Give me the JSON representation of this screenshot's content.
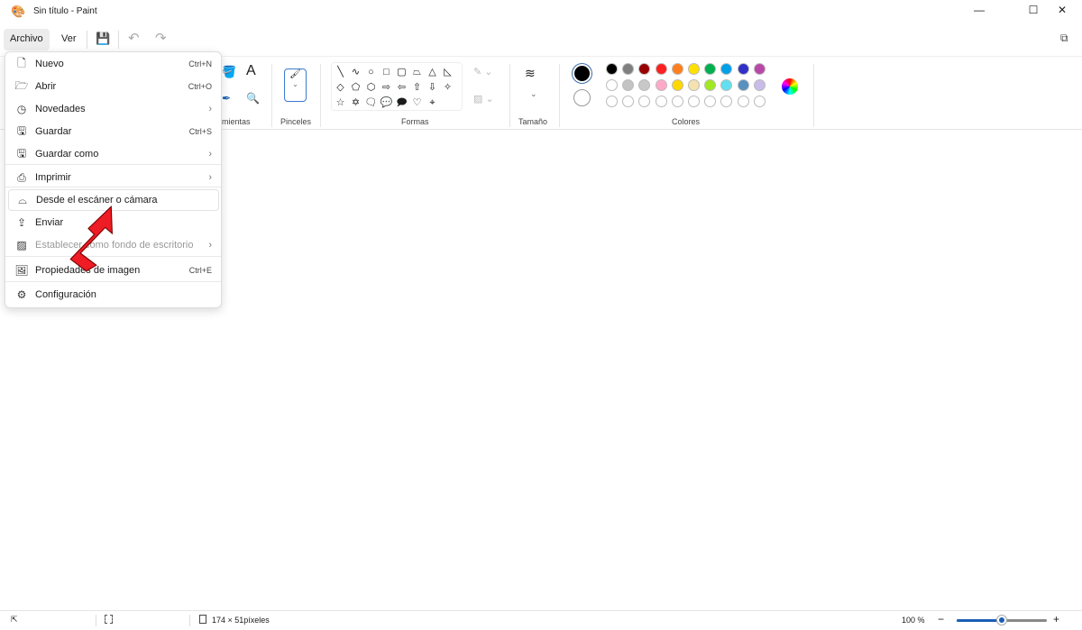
{
  "window": {
    "title": "Sin título - Paint",
    "minimize": "—",
    "maximize": "☐",
    "close": "✕"
  },
  "menubar": {
    "archivo": "Archivo",
    "ver": "Ver"
  },
  "ribbon": {
    "groups": {
      "herramientas": "mientas",
      "pinceles": "Pinceles",
      "formas": "Formas",
      "tamano": "Tamaño",
      "colores": "Colores"
    },
    "shapes": [
      "╲",
      "∿",
      "○",
      "□",
      "▢",
      "⏢",
      "△",
      "◺",
      "◇",
      "⬠",
      "⬡",
      "⇨",
      "⇦",
      "⇧",
      "⇩",
      "✧",
      "☆",
      "✡",
      "🗨",
      "💬",
      "🗩",
      "♡",
      "⌖"
    ],
    "primary_color": "#000000",
    "secondary_color": "#ffffff",
    "palette": [
      [
        "#000000",
        "#7f7f7f",
        "#990000",
        "#ff2020",
        "#ff7f1e",
        "#ffe000",
        "#00b04f",
        "#00a0e8",
        "#3030c8",
        "#b848a8"
      ],
      [
        "#ffffff",
        "#c3c3c3",
        "#c8c8c8",
        "#ffa8c8",
        "#ffd800",
        "#f5e2b0",
        "#a0e820",
        "#60e0f0",
        "#5890c0",
        "#c8bce8"
      ],
      [
        "#ffffff",
        "#ffffff",
        "#ffffff",
        "#ffffff",
        "#ffffff",
        "#ffffff",
        "#ffffff",
        "#ffffff",
        "#ffffff",
        "#ffffff"
      ]
    ]
  },
  "file_menu": {
    "items": [
      {
        "label": "Nuevo",
        "shortcut": "Ctrl+N",
        "icon": "new-file-icon"
      },
      {
        "label": "Abrir",
        "shortcut": "Ctrl+O",
        "icon": "folder-icon"
      },
      {
        "label": "Novedades",
        "submenu": true,
        "icon": "clock-icon"
      },
      {
        "label": "Guardar",
        "shortcut": "Ctrl+S",
        "icon": "save-icon"
      },
      {
        "label": "Guardar como",
        "submenu": true,
        "icon": "save-as-icon"
      },
      {
        "label": "Imprimir",
        "submenu": true,
        "icon": "printer-icon"
      },
      {
        "label": "Desde el escáner o cámara",
        "icon": "scanner-icon"
      },
      {
        "label": "Enviar",
        "icon": "share-icon"
      },
      {
        "label": "Establecer como fondo de escritorio",
        "submenu": true,
        "disabled": true,
        "icon": "wallpaper-icon"
      },
      {
        "label": "Propiedades de imagen",
        "shortcut": "Ctrl+E",
        "icon": "image-properties-icon"
      },
      {
        "label": "Configuración",
        "icon": "gear-icon"
      }
    ]
  },
  "status": {
    "selection_size": "174 × 51píxeles",
    "zoom": "100 %",
    "zoom_level_percent": 100
  },
  "annotation": {
    "arrow_color": "#ee1c24"
  }
}
